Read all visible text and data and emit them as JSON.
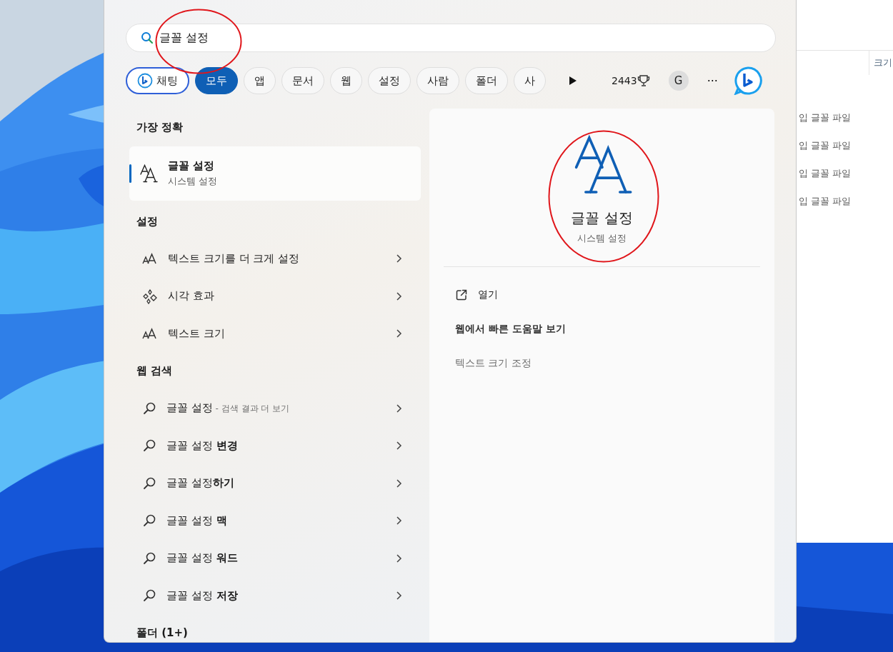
{
  "search": {
    "value": "글꼴 설정",
    "circled": true
  },
  "tabs": [
    {
      "kind": "chat",
      "label": "채팅",
      "selected": false
    },
    {
      "kind": "filter",
      "label": "모두",
      "selected": true
    },
    {
      "kind": "filter",
      "label": "앱",
      "selected": false
    },
    {
      "kind": "filter",
      "label": "문서",
      "selected": false
    },
    {
      "kind": "filter",
      "label": "웹",
      "selected": false
    },
    {
      "kind": "filter",
      "label": "설정",
      "selected": false
    },
    {
      "kind": "filter",
      "label": "사람",
      "selected": false
    },
    {
      "kind": "filter",
      "label": "폴더",
      "selected": false
    },
    {
      "kind": "filter",
      "label": "사",
      "selected": false
    }
  ],
  "toolbar": {
    "points": "2443",
    "avatar": "G",
    "more": "···"
  },
  "sections": [
    {
      "heading": "가장 정확",
      "items": [
        {
          "kind": "best",
          "text": "글꼴 설정",
          "subtitle": "시스템 설정",
          "selected": true
        }
      ]
    },
    {
      "heading": "설정",
      "items": [
        {
          "kind": "textsize",
          "text": "텍스트 크기를 더 크게 설정",
          "selected": false
        },
        {
          "kind": "effects",
          "text": "시각 효과",
          "selected": false
        },
        {
          "kind": "textsize",
          "text": "텍스트 크기",
          "selected": false
        }
      ]
    },
    {
      "heading": "웹 검색",
      "items": [
        {
          "kind": "web",
          "text": "글꼴 설정",
          "hint": "- 검색 결과 더 보기",
          "selected": false
        },
        {
          "kind": "web",
          "text": "글꼴 설정 **변경**",
          "selected": false
        },
        {
          "kind": "web",
          "text": "글꼴 설정**하기**",
          "selected": false
        },
        {
          "kind": "web",
          "text": "글꼴 설정 **맥**",
          "selected": false
        },
        {
          "kind": "web",
          "text": "글꼴 설정 **워드**",
          "selected": false
        },
        {
          "kind": "web",
          "text": "글꼴 설정 **저장**",
          "selected": false
        }
      ]
    },
    {
      "heading": "폴더 (1+)"
    }
  ],
  "preview": {
    "title": "글꼴 설정",
    "subtitle": "시스템 설정",
    "circled": true,
    "actions": [
      {
        "kind": "open",
        "label": "열기"
      },
      {
        "kind": "link",
        "label": "웹에서 빠른 도움말 보기"
      },
      {
        "kind": "related",
        "label": "텍스트 크기 조정"
      }
    ]
  },
  "background_window": {
    "column_header": "크기",
    "rows": [
      "입 글꼴 파일",
      "입 글꼴 파일",
      "입 글꼴 파일",
      "입 글꼴 파일"
    ]
  }
}
